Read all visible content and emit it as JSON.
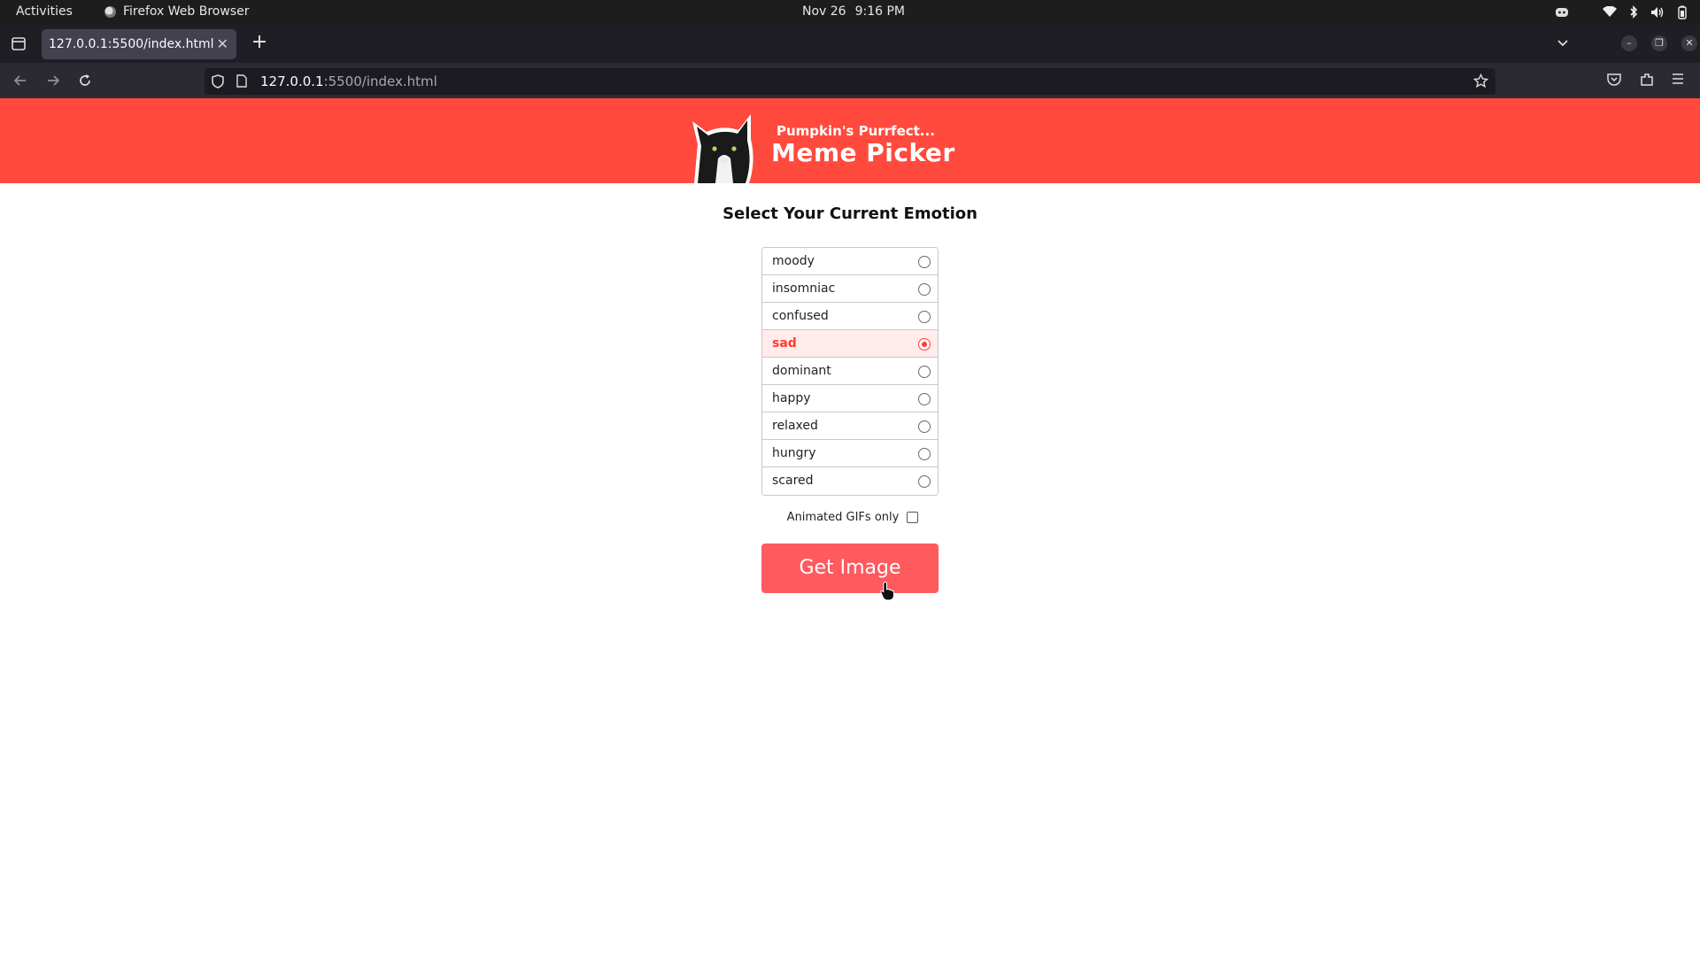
{
  "system": {
    "activities": "Activities",
    "app_name": "Firefox Web Browser",
    "date": "Nov 26",
    "time": "9:16 PM"
  },
  "browser": {
    "tab_title": "127.0.0.1:5500/index.html",
    "url_host": "127.0.0.1",
    "url_rest": ":5500/index.html"
  },
  "page": {
    "header_subtitle": "Pumpkin's Purrfect...",
    "header_title": "Meme Picker",
    "heading": "Select Your Current Emotion",
    "emotions": [
      {
        "label": "moody",
        "selected": false
      },
      {
        "label": "insomniac",
        "selected": false
      },
      {
        "label": "confused",
        "selected": false
      },
      {
        "label": "sad",
        "selected": true
      },
      {
        "label": "dominant",
        "selected": false
      },
      {
        "label": "happy",
        "selected": false
      },
      {
        "label": "relaxed",
        "selected": false
      },
      {
        "label": "hungry",
        "selected": false
      },
      {
        "label": "scared",
        "selected": false
      }
    ],
    "gif_only_label": "Animated GIFs only",
    "gif_only_checked": false,
    "button_label": "Get Image"
  },
  "colors": {
    "header_bg": "#ff4a3d",
    "accent": "#ff3b2f",
    "button_bg": "#ff5a5e",
    "selected_row_bg": "#ffeceb"
  }
}
